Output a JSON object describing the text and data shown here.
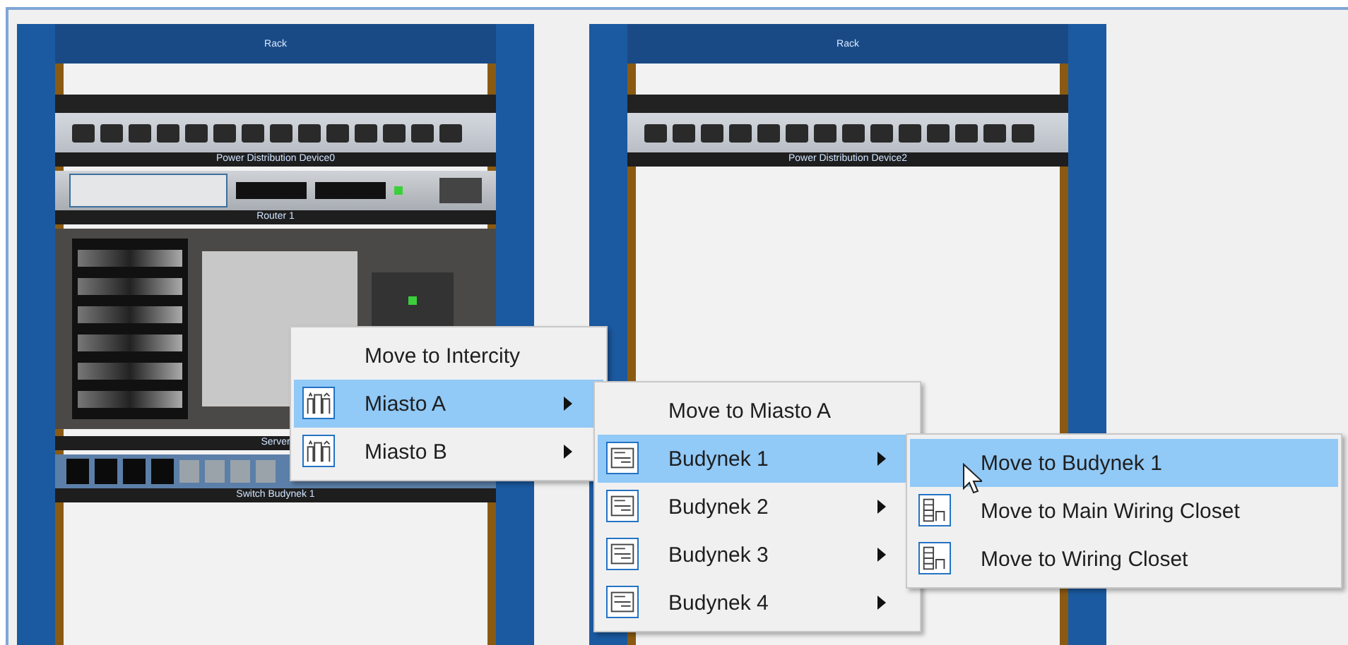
{
  "racks": [
    {
      "title": "Rack",
      "devices": [
        {
          "kind": "patch",
          "label": "Power Distribution Device0"
        },
        {
          "kind": "router",
          "label": "Router 1"
        },
        {
          "kind": "server",
          "label": "Server"
        },
        {
          "kind": "switch",
          "label": "Switch Budynek 1"
        }
      ]
    },
    {
      "title": "Rack",
      "devices": [
        {
          "kind": "patch",
          "label": "Power Distribution Device2"
        }
      ]
    }
  ],
  "menus": [
    {
      "items": [
        {
          "label": "Move to Intercity",
          "kind": "action",
          "has_icon": false,
          "selected": false
        },
        {
          "label": "Miasto A",
          "kind": "submenu",
          "has_icon": true,
          "selected": true
        },
        {
          "label": "Miasto B",
          "kind": "submenu",
          "has_icon": true,
          "selected": false
        }
      ]
    },
    {
      "items": [
        {
          "label": "Move to Miasto A",
          "kind": "action",
          "has_icon": false,
          "selected": false
        },
        {
          "label": "Budynek 1",
          "kind": "submenu",
          "has_icon": true,
          "selected": true
        },
        {
          "label": "Budynek 2",
          "kind": "submenu",
          "has_icon": true,
          "selected": false
        },
        {
          "label": "Budynek 3",
          "kind": "submenu",
          "has_icon": true,
          "selected": false
        },
        {
          "label": "Budynek 4",
          "kind": "submenu",
          "has_icon": true,
          "selected": false
        }
      ]
    },
    {
      "items": [
        {
          "label": "Move to Budynek 1",
          "kind": "action",
          "has_icon": false,
          "selected": true
        },
        {
          "label": "Move to Main Wiring Closet",
          "kind": "action",
          "has_icon": true,
          "selected": false
        },
        {
          "label": "Move to Wiring Closet",
          "kind": "action",
          "has_icon": true,
          "selected": false
        }
      ]
    }
  ]
}
